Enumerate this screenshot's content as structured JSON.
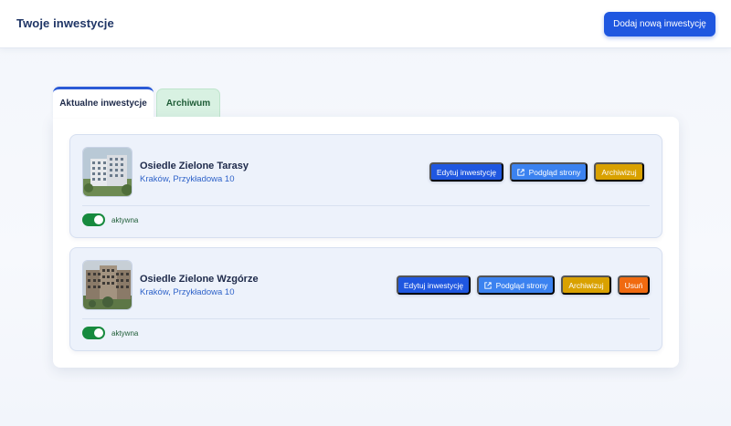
{
  "header": {
    "title": "Twoje inwestycje",
    "add_button_label": "Dodaj nową inwestycję"
  },
  "tabs": [
    {
      "label": "Aktualne inwestycje",
      "active": true
    },
    {
      "label": "Archiwum",
      "active": false
    }
  ],
  "investments": [
    {
      "name": "Osiedle Zielone Tarasy",
      "address": "Kraków, Przykładowa 10",
      "status": "aktywna",
      "active": true,
      "actions": {
        "edit": "Edytuj inwestycję",
        "preview": "Podgląd strony",
        "archive": "Archiwizuj"
      }
    },
    {
      "name": "Osiedle Zielone Wzgórze",
      "address": "Kraków, Przykładowa 10",
      "status": "aktywna",
      "active": true,
      "actions": {
        "edit": "Edytuj inwestycję",
        "preview": "Podgląd strony",
        "archive": "Archiwizuj",
        "delete": "Usuń"
      }
    }
  ],
  "colors": {
    "primary": "#1f57e0",
    "preview": "#3b82f0",
    "archive": "#d9a100",
    "delete": "#f06a10",
    "toggle_on": "#178a3e",
    "archive_tab": "#d8f1e2"
  },
  "icons": {
    "external_link": "external-link-icon"
  }
}
